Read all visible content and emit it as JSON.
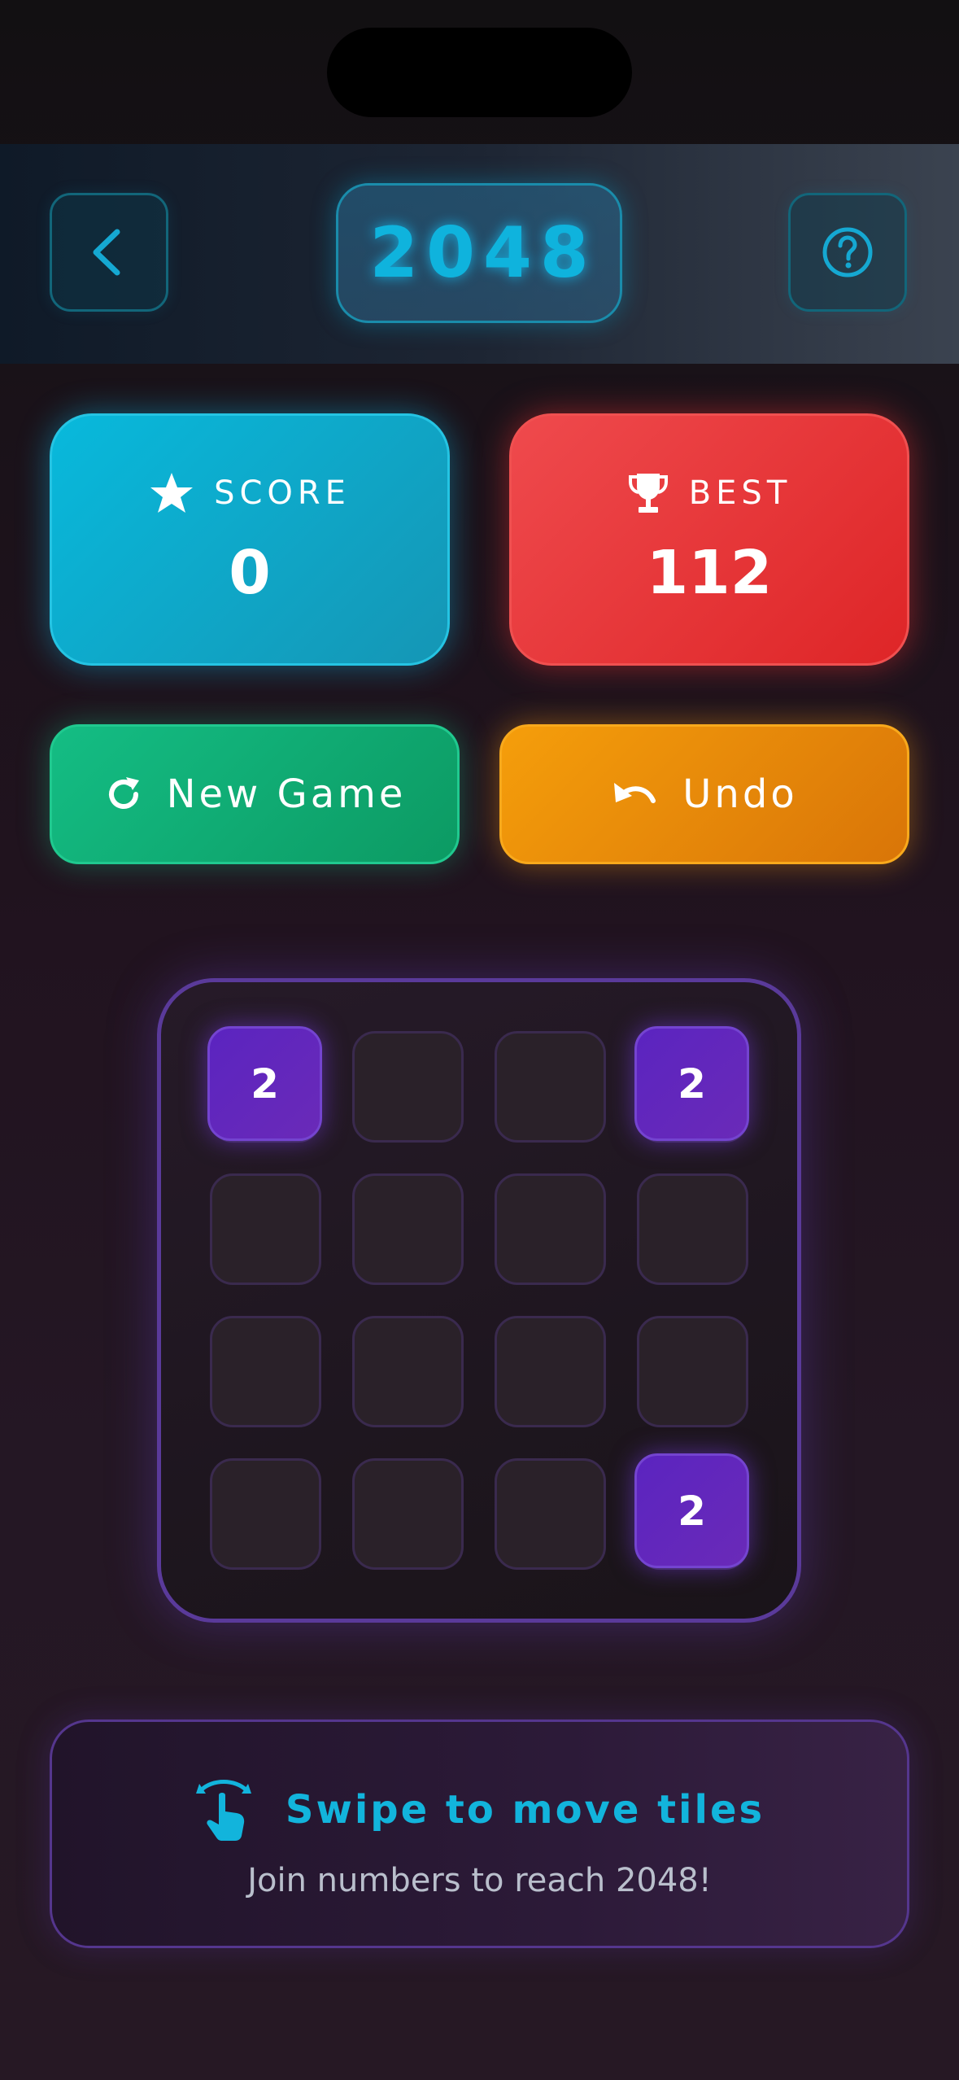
{
  "header": {
    "title": "2048",
    "back_icon": "chevron-left-icon",
    "help_icon": "question-circle-icon"
  },
  "stats": {
    "score": {
      "label": "SCORE",
      "value": "0",
      "icon": "star-icon",
      "color": "#08b9dc"
    },
    "best": {
      "label": "BEST",
      "value": "112",
      "icon": "trophy-icon",
      "color": "#e83335"
    }
  },
  "actions": {
    "new_game": {
      "label": "New Game",
      "icon": "refresh-icon",
      "color": "#12ae75"
    },
    "undo": {
      "label": "Undo",
      "icon": "undo-icon",
      "color": "#ec8a0a"
    }
  },
  "board": {
    "rows": [
      [
        "2",
        "",
        "",
        "2"
      ],
      [
        "",
        "",
        "",
        ""
      ],
      [
        "",
        "",
        "",
        ""
      ],
      [
        "",
        "",
        "",
        "2"
      ]
    ],
    "tile_color": "#5b24c0"
  },
  "hint": {
    "title": "Swipe to move tiles",
    "subtitle": "Join numbers to reach 2048!",
    "icon": "swipe-gesture-icon"
  }
}
